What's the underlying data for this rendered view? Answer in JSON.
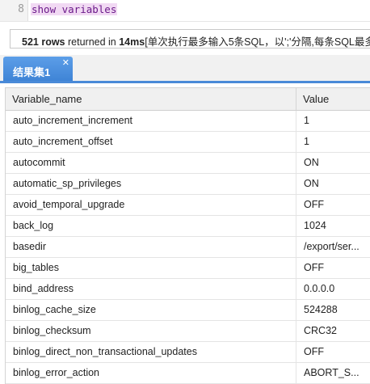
{
  "editor": {
    "line_number": "8",
    "code": "show variables"
  },
  "status": {
    "rows_count": "521 rows",
    "returned_in": " returned in ",
    "duration": "14ms",
    "note": "[单次执行最多输入5条SQL，以';'分隔,每条SQL最多返"
  },
  "tabs": [
    {
      "label": "结果集1",
      "close": "✕"
    }
  ],
  "grid": {
    "columns": [
      "Variable_name",
      "Value"
    ],
    "rows": [
      [
        "auto_increment_increment",
        "1"
      ],
      [
        "auto_increment_offset",
        "1"
      ],
      [
        "autocommit",
        "ON"
      ],
      [
        "automatic_sp_privileges",
        "ON"
      ],
      [
        "avoid_temporal_upgrade",
        "OFF"
      ],
      [
        "back_log",
        "1024"
      ],
      [
        "basedir",
        "/export/ser..."
      ],
      [
        "big_tables",
        "OFF"
      ],
      [
        "bind_address",
        "0.0.0.0"
      ],
      [
        "binlog_cache_size",
        "524288"
      ],
      [
        "binlog_checksum",
        "CRC32"
      ],
      [
        "binlog_direct_non_transactional_updates",
        "OFF"
      ],
      [
        "binlog_error_action",
        "ABORT_S..."
      ]
    ]
  }
}
